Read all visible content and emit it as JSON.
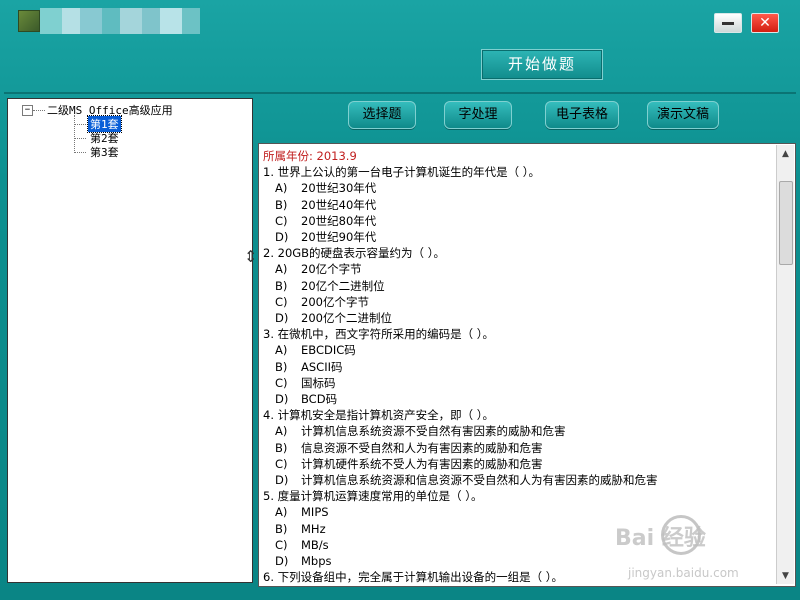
{
  "window": {
    "title_blur_colors": [
      "#7fd0d0",
      "#b5e0e5",
      "#88c9d2",
      "#5fbcc0",
      "#a4d5db",
      "#7fc4cb",
      "#b8e3e8",
      "#6cc2c5"
    ]
  },
  "toolbar": {
    "start_label": "开始做题",
    "minimize_label": "",
    "close_label": "✕"
  },
  "tree": {
    "root_label": "二级MS Office高级应用",
    "expander": "−",
    "children": [
      "第1套",
      "第2套",
      "第3套"
    ],
    "selected_index": 0
  },
  "categories": [
    "选择题",
    "字处理",
    "电子表格",
    "演示文稿"
  ],
  "questions": {
    "year": "所属年份: 2013.9",
    "items": [
      {
        "q": "1. 世界上公认的第一台电子计算机诞生的年代是（ ）。",
        "opts": [
          [
            "A)",
            "20世纪30年代"
          ],
          [
            "B)",
            "20世纪40年代"
          ],
          [
            "C)",
            "20世纪80年代"
          ],
          [
            "D)",
            "20世纪90年代"
          ]
        ]
      },
      {
        "q": "2. 20GB的硬盘表示容量约为（ ）。",
        "opts": [
          [
            "A)",
            "20亿个字节"
          ],
          [
            "B)",
            "20亿个二进制位"
          ],
          [
            "C)",
            "200亿个字节"
          ],
          [
            "D)",
            "200亿个二进制位"
          ]
        ]
      },
      {
        "q": "3. 在微机中，西文字符所采用的编码是（ ）。",
        "opts": [
          [
            "A)",
            "EBCDIC码"
          ],
          [
            "B)",
            "ASCII码"
          ],
          [
            "C)",
            "国标码"
          ],
          [
            "D)",
            "BCD码"
          ]
        ]
      },
      {
        "q": "4. 计算机安全是指计算机资产安全，即（ ）。",
        "opts": [
          [
            "A)",
            "计算机信息系统资源不受自然有害因素的威胁和危害"
          ],
          [
            "B)",
            "信息资源不受自然和人为有害因素的威胁和危害"
          ],
          [
            "C)",
            "计算机硬件系统不受人为有害因素的威胁和危害"
          ],
          [
            "D)",
            "计算机信息系统资源和信息资源不受自然和人为有害因素的威胁和危害"
          ]
        ]
      },
      {
        "q": "5. 度量计算机运算速度常用的单位是（ ）。",
        "opts": [
          [
            "A)",
            "MIPS"
          ],
          [
            "B)",
            "MHz"
          ],
          [
            "C)",
            "MB/s"
          ],
          [
            "D)",
            "Mbps"
          ]
        ]
      },
      {
        "q": "6. 下列设备组中，完全属于计算机输出设备的一组是（ ）。",
        "opts": []
      }
    ]
  },
  "watermark": {
    "text": "Bai 经验",
    "sub": "jingyan.baidu.com"
  }
}
